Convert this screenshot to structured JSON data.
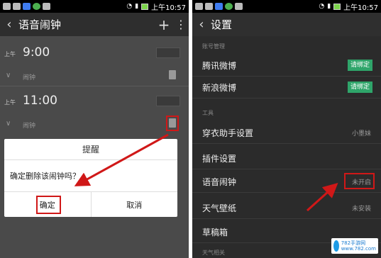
{
  "status_bar": {
    "time": "上午10:57"
  },
  "left": {
    "header": {
      "back": "‹",
      "title": "语音闹钟",
      "add": "+",
      "more": "⋮"
    },
    "alarms": [
      {
        "ampm": "上午",
        "time": "9:00",
        "tag": "闹钟"
      },
      {
        "ampm": "上午",
        "time": "11:00",
        "tag": "闹钟"
      }
    ],
    "dialog": {
      "title": "提醒",
      "message": "确定删除该闹钟吗？",
      "confirm": "确定",
      "cancel": "取消"
    }
  },
  "right": {
    "header": {
      "back": "‹",
      "title": "设置"
    },
    "sections": {
      "account": "账号管理",
      "tools": "工具",
      "weather": "天气相关"
    },
    "rows": {
      "tencent": {
        "label": "腾讯微博",
        "badge": "请绑定"
      },
      "sina": {
        "label": "新浪微博",
        "badge": "请绑定"
      },
      "dress": {
        "label": "穿衣助手设置",
        "value": "小墨妹"
      },
      "plugin": {
        "label": "插件设置"
      },
      "voice": {
        "label": "语音闹钟",
        "value": "未开启"
      },
      "wallpaper": {
        "label": "天气壁纸",
        "value": "未安装"
      },
      "drafts": {
        "label": "草稿箱"
      }
    }
  },
  "watermark": {
    "line1": "782手游网",
    "line2": "www.782.com"
  },
  "colors": {
    "highlight": "#d01818",
    "badge": "#2fa56a"
  }
}
